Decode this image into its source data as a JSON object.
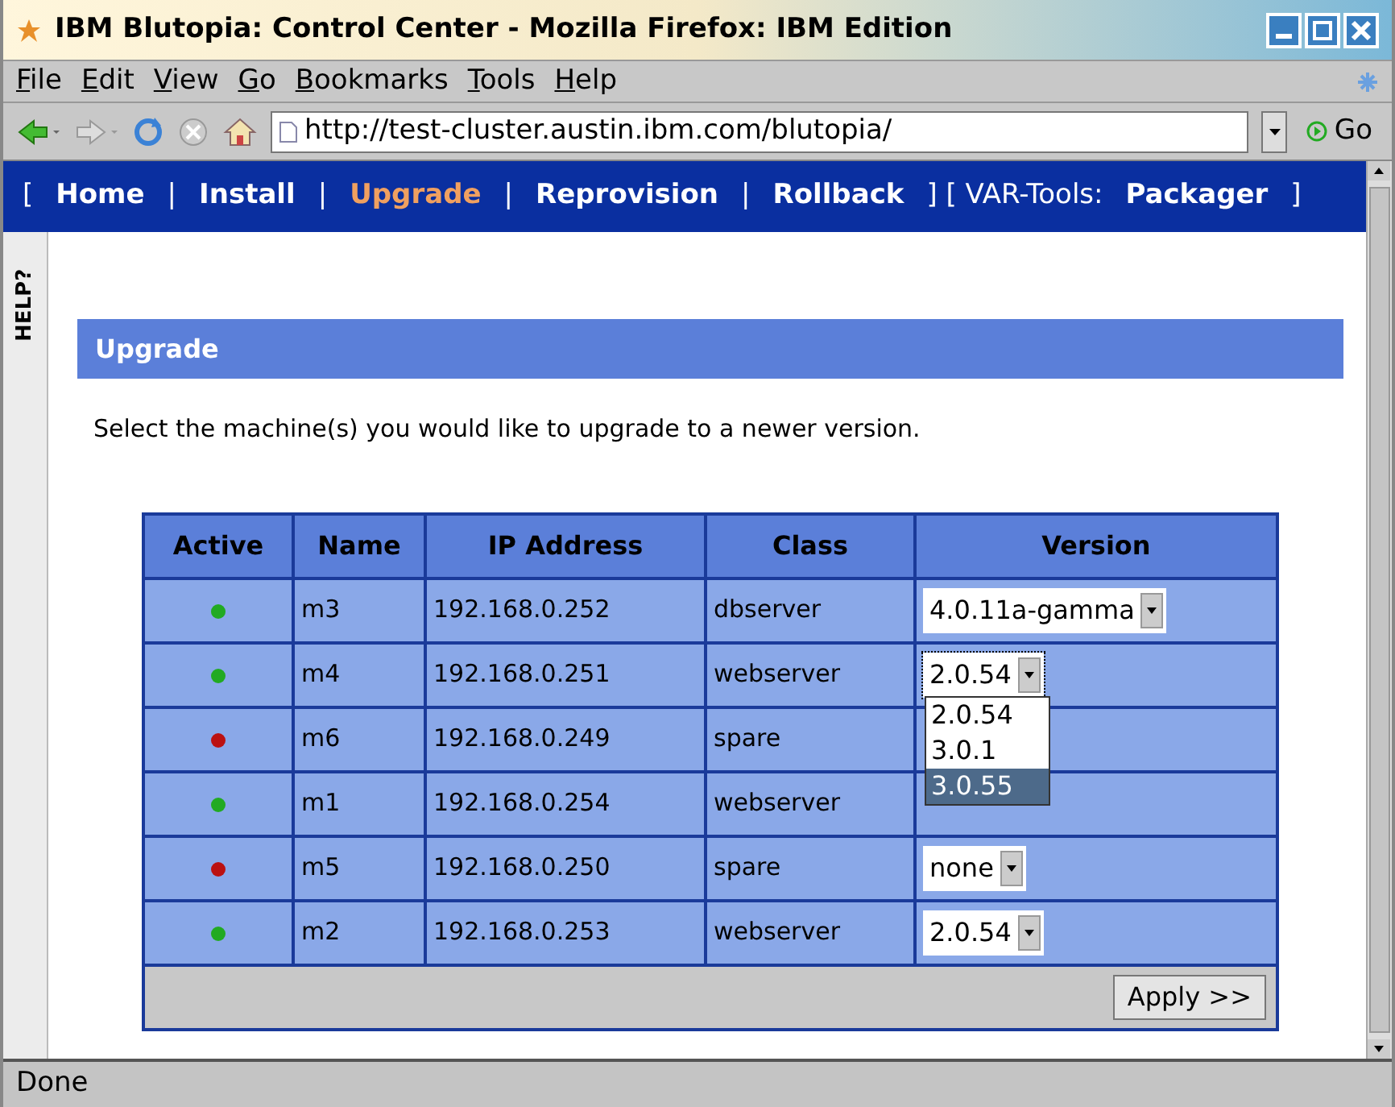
{
  "window": {
    "title": "IBM Blutopia: Control Center - Mozilla Firefox: IBM Edition"
  },
  "menu": [
    "File",
    "Edit",
    "View",
    "Go",
    "Bookmarks",
    "Tools",
    "Help"
  ],
  "address_bar": {
    "value": "http://test-cluster.austin.ibm.com/blutopia/",
    "go": "Go"
  },
  "nav": [
    {
      "kind": "mark",
      "text": "["
    },
    {
      "kind": "link",
      "text": "Home",
      "selected": false
    },
    {
      "kind": "mark",
      "text": "|"
    },
    {
      "kind": "link",
      "text": "Install",
      "selected": false
    },
    {
      "kind": "mark",
      "text": "|"
    },
    {
      "kind": "link",
      "text": "Upgrade",
      "selected": true
    },
    {
      "kind": "mark",
      "text": "|"
    },
    {
      "kind": "link",
      "text": "Reprovision",
      "selected": false
    },
    {
      "kind": "mark",
      "text": "|"
    },
    {
      "kind": "link",
      "text": "Rollback",
      "selected": false
    },
    {
      "kind": "mark",
      "text": "] [ VAR-Tools:"
    },
    {
      "kind": "link",
      "text": "Packager",
      "selected": false
    },
    {
      "kind": "mark",
      "text": "]"
    }
  ],
  "help_tab": "HELP?",
  "section": {
    "title": "Upgrade",
    "instructions": "Select the machine(s) you would like to upgrade to a newer version."
  },
  "table": {
    "columns": [
      "Active",
      "Name",
      "IP Address",
      "Class",
      "Version"
    ],
    "rows": [
      {
        "color": "#22aa22",
        "name": "m3",
        "ip": "192.168.0.252",
        "class": "dbserver",
        "version": "4.0.11a-gamma"
      },
      {
        "color": "#22aa22",
        "name": "m4",
        "ip": "192.168.0.251",
        "class": "webserver",
        "version": "2.0.54",
        "focused": true
      },
      {
        "color": "#bb1111",
        "name": "m6",
        "ip": "192.168.0.249",
        "class": "spare"
      },
      {
        "color": "#22aa22",
        "name": "m1",
        "ip": "192.168.0.254",
        "class": "webserver"
      },
      {
        "color": "#bb1111",
        "name": "m5",
        "ip": "192.168.0.250",
        "class": "spare",
        "version": "none"
      },
      {
        "color": "#22aa22",
        "name": "m2",
        "ip": "192.168.0.253",
        "class": "webserver",
        "version": "2.0.54"
      }
    ],
    "apply": "Apply >>"
  },
  "dropdown": {
    "options": [
      {
        "text": "2.0.54",
        "selected": false
      },
      {
        "text": "3.0.1",
        "selected": false
      },
      {
        "text": "3.0.55",
        "selected": true
      }
    ]
  },
  "status_bar": "Done"
}
